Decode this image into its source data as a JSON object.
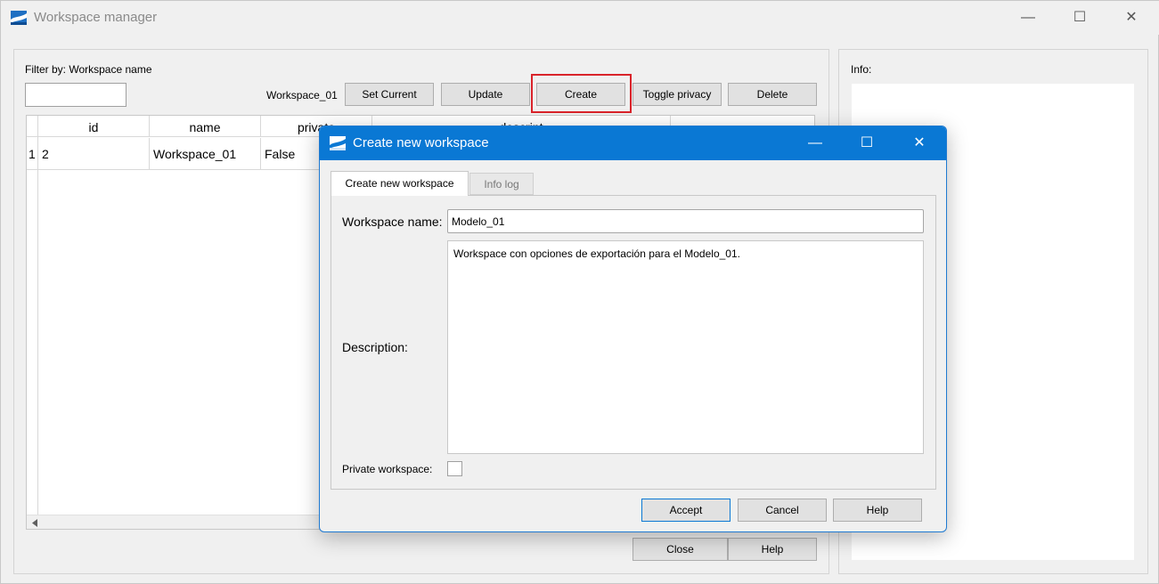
{
  "main": {
    "title": "Workspace manager",
    "filter_label": "Filter by: Workspace name",
    "filter_value": "",
    "current_workspace": "Workspace_01",
    "buttons": {
      "set_current": "Set Current",
      "update": "Update",
      "create": "Create",
      "toggle_privacy": "Toggle privacy",
      "delete": "Delete",
      "close": "Close",
      "help": "Help"
    },
    "table": {
      "columns": [
        "id",
        "name",
        "private",
        "descript"
      ],
      "rows": [
        {
          "row_number": "1",
          "id": "2",
          "name": "Workspace_01",
          "private": "False"
        }
      ]
    },
    "info_label": "Info:",
    "highlight_color": "#d9232a"
  },
  "dialog": {
    "title": "Create new workspace",
    "tabs": [
      "Create new workspace",
      "Info log"
    ],
    "workspace_name_label": "Workspace name:",
    "workspace_name_value": "Modelo_01",
    "description_label": "Description:",
    "description_value": "Workspace con opciones de exportación para el Modelo_01.",
    "private_label": "Private workspace:",
    "private_checked": false,
    "buttons": {
      "accept": "Accept",
      "cancel": "Cancel",
      "help": "Help"
    },
    "accent_color": "#0a78d4"
  },
  "window_controls": {
    "minimize": "—",
    "maximize": "☐",
    "close": "✕"
  }
}
